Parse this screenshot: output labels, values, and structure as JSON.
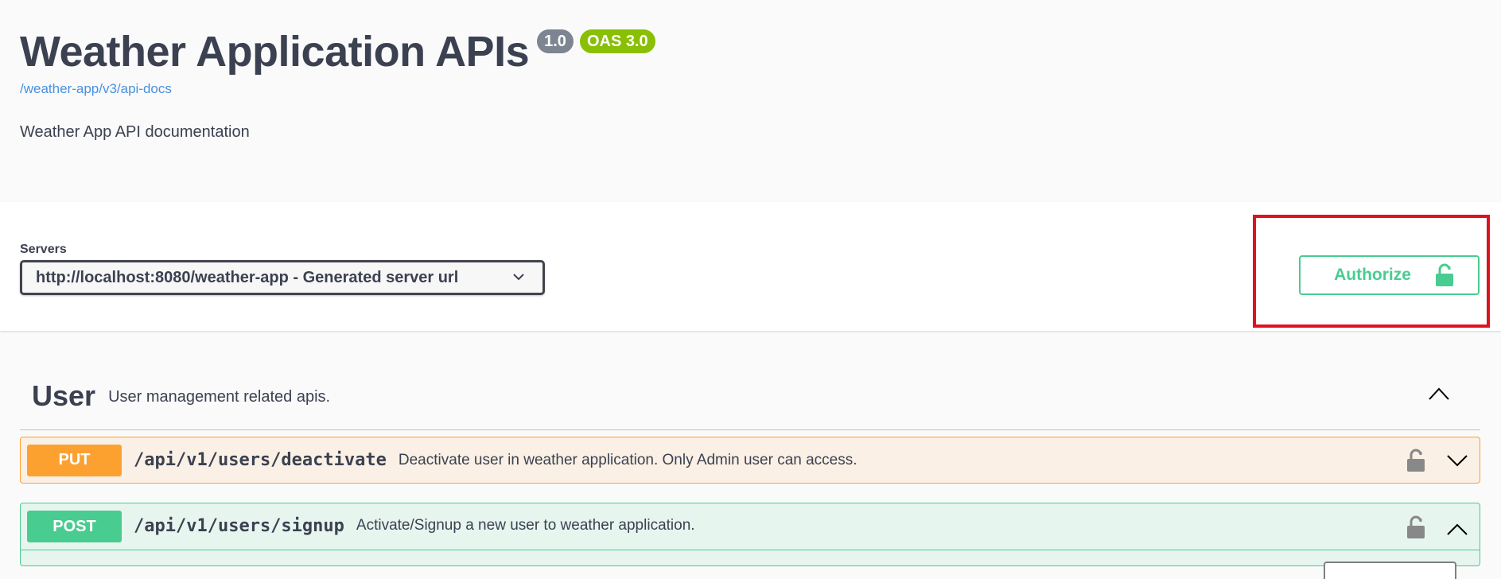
{
  "info": {
    "title": "Weather Application APIs",
    "version": "1.0",
    "oas": "OAS 3.0",
    "doc_link": "/weather-app/v3/api-docs",
    "description": "Weather App API documentation"
  },
  "servers": {
    "label": "Servers",
    "selected": "http://localhost:8080/weather-app - Generated server url"
  },
  "authorize": {
    "label": "Authorize",
    "color": "#49cc90"
  },
  "tag": {
    "name": "User",
    "description": "User management related apis."
  },
  "operations": [
    {
      "method": "PUT",
      "path": "/api/v1/users/deactivate",
      "summary": "Deactivate user in weather application. Only Admin user can access.",
      "color": "#fca130"
    },
    {
      "method": "POST",
      "path": "/api/v1/users/signup",
      "summary": "Activate/Signup a new user to weather application.",
      "color": "#49cc90"
    }
  ],
  "icons": [
    "chevron-down-icon",
    "unlock-icon",
    "chevron-up-icon",
    "lock-icon"
  ]
}
